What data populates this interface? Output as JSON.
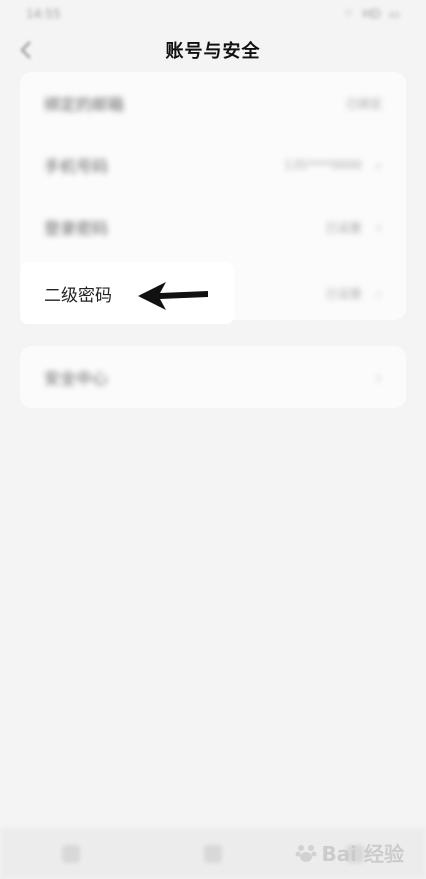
{
  "status_bar": {
    "time": "14:55",
    "network": "HD",
    "battery": "88"
  },
  "header": {
    "title": "账号与安全"
  },
  "card1": {
    "rows": [
      {
        "label": "绑定的邮箱",
        "value": "已绑定"
      },
      {
        "label": "手机号码",
        "value": "135****0000"
      },
      {
        "label": "登录密码",
        "value": "已设置"
      },
      {
        "label": "二级密码",
        "value": "已设置"
      }
    ]
  },
  "card2": {
    "rows": [
      {
        "label": "安全中心"
      }
    ]
  },
  "watermark": {
    "text": "Bai 经验"
  }
}
